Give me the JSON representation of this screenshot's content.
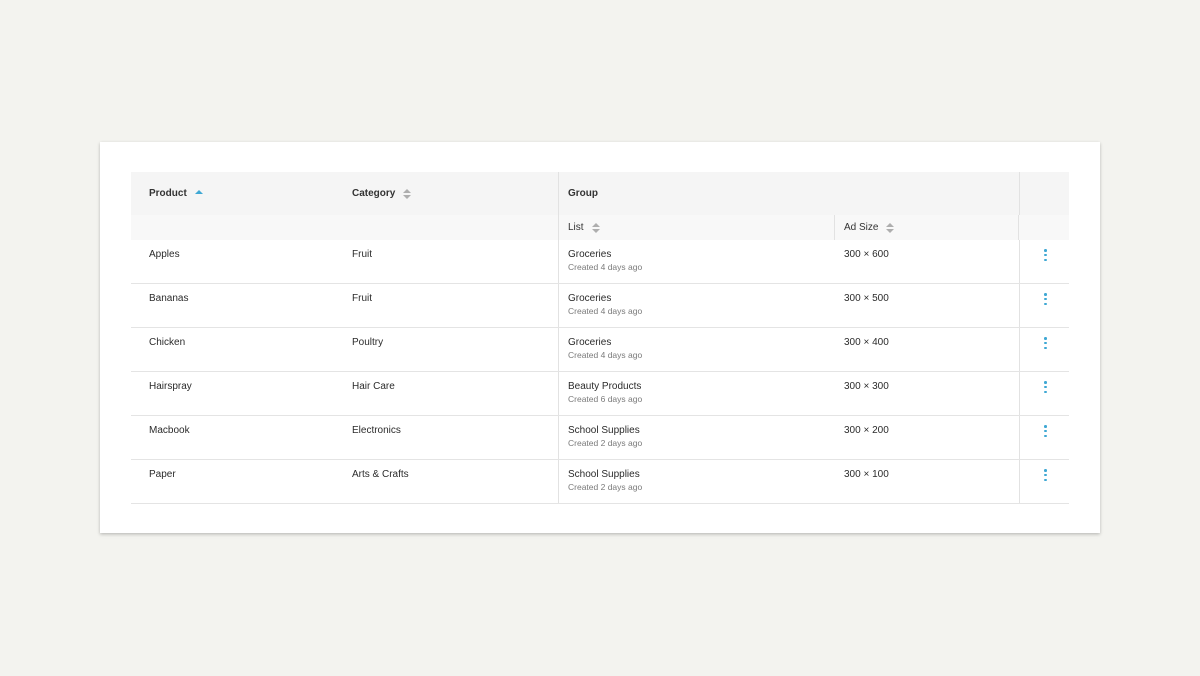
{
  "table": {
    "headers": {
      "product": "Product",
      "category": "Category",
      "group": "Group",
      "list": "List",
      "ad_size": "Ad Size"
    },
    "sort": {
      "column": "product",
      "direction": "ascending"
    },
    "rows": [
      {
        "product": "Apples",
        "category": "Fruit",
        "list": "Groceries",
        "created": "Created 4 days ago",
        "ad_size": "300 × 600"
      },
      {
        "product": "Bananas",
        "category": "Fruit",
        "list": "Groceries",
        "created": "Created 4 days ago",
        "ad_size": "300 × 500"
      },
      {
        "product": "Chicken",
        "category": "Poultry",
        "list": "Groceries",
        "created": "Created 4 days ago",
        "ad_size": "300 × 400"
      },
      {
        "product": "Hairspray",
        "category": "Hair Care",
        "list": "Beauty Products",
        "created": "Created 6 days ago",
        "ad_size": "300 × 300"
      },
      {
        "product": "Macbook",
        "category": "Electronics",
        "list": "School Supplies",
        "created": "Created 2 days ago",
        "ad_size": "300 × 200"
      },
      {
        "product": "Paper",
        "category": "Arts & Crafts",
        "list": "School Supplies",
        "created": "Created 2 days ago",
        "ad_size": "300 × 100"
      }
    ],
    "row_action_icon": "more-vertical-icon"
  },
  "colors": {
    "accent": "#3fa8d4",
    "background": "#f3f3ef",
    "header_bg": "#f5f5f5"
  }
}
